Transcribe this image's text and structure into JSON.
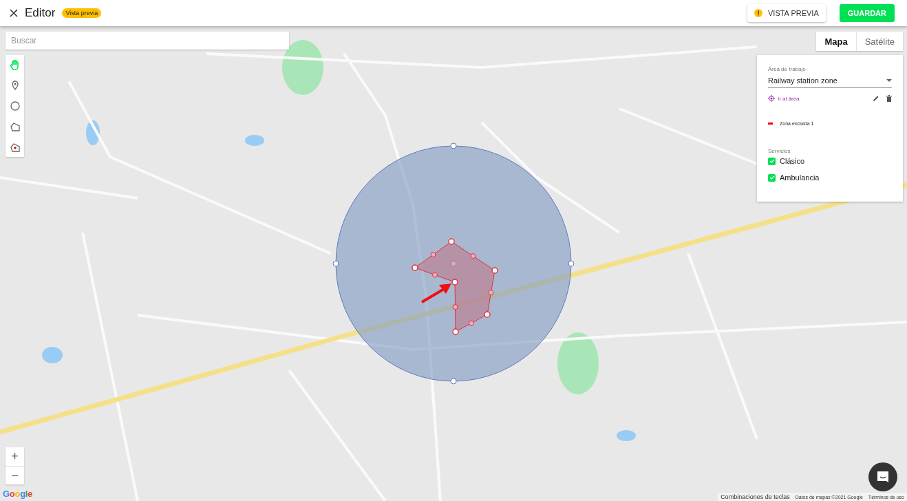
{
  "header": {
    "title": "Editor",
    "badge": "Vista previa",
    "preview_button": "VISTA PREVIA",
    "save_button": "GUARDAR"
  },
  "search": {
    "placeholder": "Buscar"
  },
  "tools": [
    {
      "kind": "hand",
      "selected": true
    },
    {
      "kind": "pin",
      "selected": false
    },
    {
      "kind": "circle",
      "selected": false
    },
    {
      "kind": "polygon",
      "selected": false
    },
    {
      "kind": "exclusion",
      "selected": false
    }
  ],
  "map_types": [
    {
      "label": "Mapa",
      "selected": true
    },
    {
      "label": "Satélite",
      "selected": false
    }
  ],
  "panel": {
    "area_label": "Área de trabajo",
    "area_value": "Railway station zone",
    "go_link": "Ir al área",
    "zones": [
      {
        "name": "Zona excluida 1",
        "color": "#ff0000"
      }
    ],
    "services_label": "Servicios",
    "services": [
      {
        "label": "Clásico",
        "checked": true
      },
      {
        "label": "Ambulancia",
        "checked": true
      }
    ]
  },
  "zoom": {
    "in": "+",
    "out": "−"
  },
  "logo": "Google",
  "footer": [
    "Combinaciones de teclas",
    "Datos de mapas ©2021 Google",
    "Términos de uso"
  ]
}
